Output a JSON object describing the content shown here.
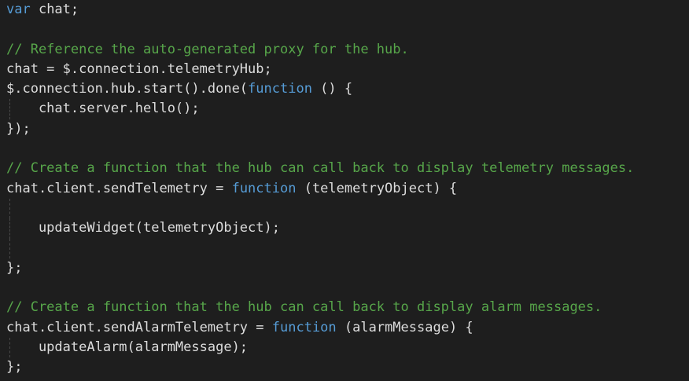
{
  "editor": {
    "language": "javascript",
    "colors": {
      "background": "#1e1e1e",
      "text": "#dcdcdc",
      "keyword": "#569cd6",
      "comment": "#57a64a",
      "indent_guide": "#4a4a4a"
    },
    "lines": [
      {
        "guide": false,
        "tokens": [
          {
            "t": "kw",
            "v": "var"
          },
          {
            "t": "tx",
            "v": " chat;"
          }
        ]
      },
      {
        "guide": false,
        "tokens": []
      },
      {
        "guide": false,
        "tokens": [
          {
            "t": "cm",
            "v": "// Reference the auto-generated proxy for the hub."
          }
        ]
      },
      {
        "guide": false,
        "tokens": [
          {
            "t": "tx",
            "v": "chat = $.connection.telemetryHub;"
          }
        ]
      },
      {
        "guide": false,
        "tokens": [
          {
            "t": "tx",
            "v": "$.connection.hub.start().done("
          },
          {
            "t": "kw",
            "v": "function"
          },
          {
            "t": "tx",
            "v": " () {"
          }
        ]
      },
      {
        "guide": true,
        "tokens": [
          {
            "t": "tx",
            "v": "    chat.server.hello();"
          }
        ]
      },
      {
        "guide": false,
        "tokens": [
          {
            "t": "tx",
            "v": "});"
          }
        ]
      },
      {
        "guide": false,
        "tokens": []
      },
      {
        "guide": false,
        "tokens": [
          {
            "t": "cm",
            "v": "// Create a function that the hub can call back to display telemetry messages."
          }
        ]
      },
      {
        "guide": false,
        "tokens": [
          {
            "t": "tx",
            "v": "chat.client.sendTelemetry = "
          },
          {
            "t": "kw",
            "v": "function"
          },
          {
            "t": "tx",
            "v": " (telemetryObject) {"
          }
        ]
      },
      {
        "guide": true,
        "tokens": []
      },
      {
        "guide": true,
        "tokens": [
          {
            "t": "tx",
            "v": "    updateWidget(telemetryObject);"
          }
        ]
      },
      {
        "guide": true,
        "tokens": []
      },
      {
        "guide": false,
        "tokens": [
          {
            "t": "tx",
            "v": "};"
          }
        ]
      },
      {
        "guide": false,
        "tokens": []
      },
      {
        "guide": false,
        "tokens": [
          {
            "t": "cm",
            "v": "// Create a function that the hub can call back to display alarm messages."
          }
        ]
      },
      {
        "guide": false,
        "tokens": [
          {
            "t": "tx",
            "v": "chat.client.sendAlarmTelemetry = "
          },
          {
            "t": "kw",
            "v": "function"
          },
          {
            "t": "tx",
            "v": " (alarmMessage) {"
          }
        ]
      },
      {
        "guide": true,
        "tokens": [
          {
            "t": "tx",
            "v": "    updateAlarm(alarmMessage);"
          }
        ]
      },
      {
        "guide": false,
        "tokens": [
          {
            "t": "tx",
            "v": "};"
          }
        ]
      }
    ]
  }
}
